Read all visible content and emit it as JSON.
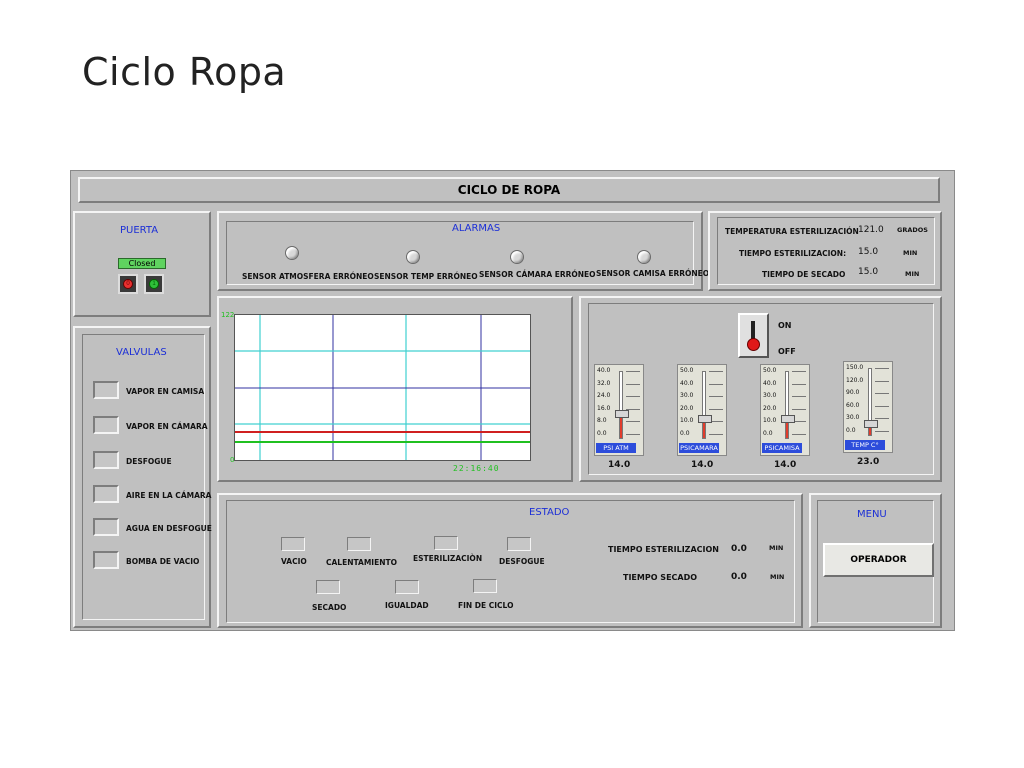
{
  "slide_title": "Ciclo Ropa",
  "header": {
    "title": "CICLO DE ROPA"
  },
  "puerta": {
    "title": "PUERTA",
    "status": "Closed",
    "btn_off": "0",
    "btn_on": "1"
  },
  "alarmas": {
    "title": "ALARMAS",
    "items": [
      "SENSOR ATMOSFERA ERRÓNEO",
      "SENSOR TEMP ERRÓNEO",
      "SENSOR CÁMARA  ERRÓNEO",
      "SENSOR CAMISA ERRÓNEO"
    ]
  },
  "params": {
    "temp_label": "TEMPERATURA ESTERILIZACIÓN",
    "temp_value": "121.0",
    "temp_unit": "GRADOS",
    "tiempo_label": "TIEMPO ESTERILIZACION:",
    "tiempo_value": "15.0",
    "tiempo_unit": "MIN",
    "secado_label": "TIEMPO DE SECADO",
    "secado_value": "15.0",
    "secado_unit": "MIN"
  },
  "valvulas": {
    "title": "VALVULAS",
    "items": [
      "VAPOR EN CAMISA",
      "VAPOR EN CÁMARA",
      "DESFOGUE",
      "AIRE EN LA CÁMARA",
      "AGUA EN DESFOGUE",
      "BOMBA DE VACIO"
    ]
  },
  "trend": {
    "y_max": "122",
    "y_min": "0",
    "time": "22:16:40",
    "colors": {
      "grid_cyan": "#40d0d0",
      "grid_blue": "#3030a0",
      "red": "#d02020",
      "green": "#20c020",
      "axis_text": "#20c020"
    }
  },
  "switch": {
    "on": "ON",
    "off": "OFF"
  },
  "gauges": [
    {
      "label": "PSI ATM",
      "value": "14.0",
      "scale": [
        "40.0",
        "32.0",
        "24.0",
        "16.0",
        "8.0",
        "0.0"
      ],
      "max": 40,
      "level": 14
    },
    {
      "label": "PSICAMARA",
      "value": "14.0",
      "scale": [
        "50.0",
        "40.0",
        "30.0",
        "20.0",
        "10.0",
        "0.0"
      ],
      "max": 50,
      "level": 14
    },
    {
      "label": "PSICAMISA",
      "value": "14.0",
      "scale": [
        "50.0",
        "40.0",
        "30.0",
        "20.0",
        "10.0",
        "0.0"
      ],
      "max": 50,
      "level": 14
    },
    {
      "label": "TEMP C°",
      "value": "23.0",
      "scale": [
        "150.0",
        "120.0",
        "90.0",
        "60.0",
        "30.0",
        "0.0"
      ],
      "max": 150,
      "level": 23
    }
  ],
  "estado": {
    "title": "ESTADO",
    "items": [
      "VACIO",
      "CALENTAMIENTO",
      "ESTERILIZACIÒN",
      "DESFOGUE",
      "SECADO",
      "IGUALDAD",
      "FIN DE CICLO"
    ],
    "t_est_label": "TIEMPO ESTERILIZACION",
    "t_est_value": "0.0",
    "t_est_unit": "MIN",
    "t_sec_label": "TIEMPO SECADO",
    "t_sec_value": "0.0",
    "t_sec_unit": "MIN"
  },
  "menu": {
    "title": "MENU",
    "operador": "OPERADOR"
  }
}
